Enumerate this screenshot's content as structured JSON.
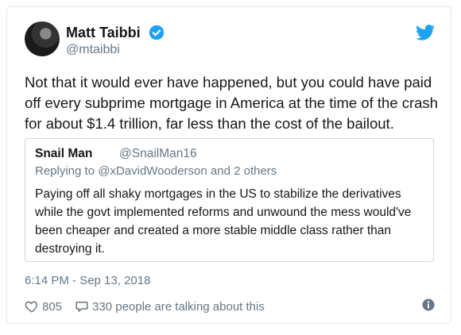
{
  "tweet": {
    "author_name": "Matt Taibbi",
    "author_handle": "@mtaibbi",
    "verified_icon": "verified-badge-icon",
    "platform_icon": "twitter-bird-icon",
    "text": "Not that it would ever have happened, but you could have paid off every subprime mortgage in America at the time of the crash for about $1.4 trillion, far less than the cost of the bailout.",
    "timestamp": "6:14 PM - Sep 13, 2018",
    "likes": "805",
    "conversation": "330 people are talking about this",
    "accent_color": "#1da1f2"
  },
  "quoted": {
    "author_name": "Snail Man",
    "author_handle": "@SnailMan16",
    "replying_to": "Replying to @xDavidWooderson and 2 others",
    "text": "Paying off all shaky mortgages in the US to stabilize the derivatives while the govt implemented reforms and unwound the mess would've been cheaper and created a more stable middle class rather than destroying it."
  }
}
